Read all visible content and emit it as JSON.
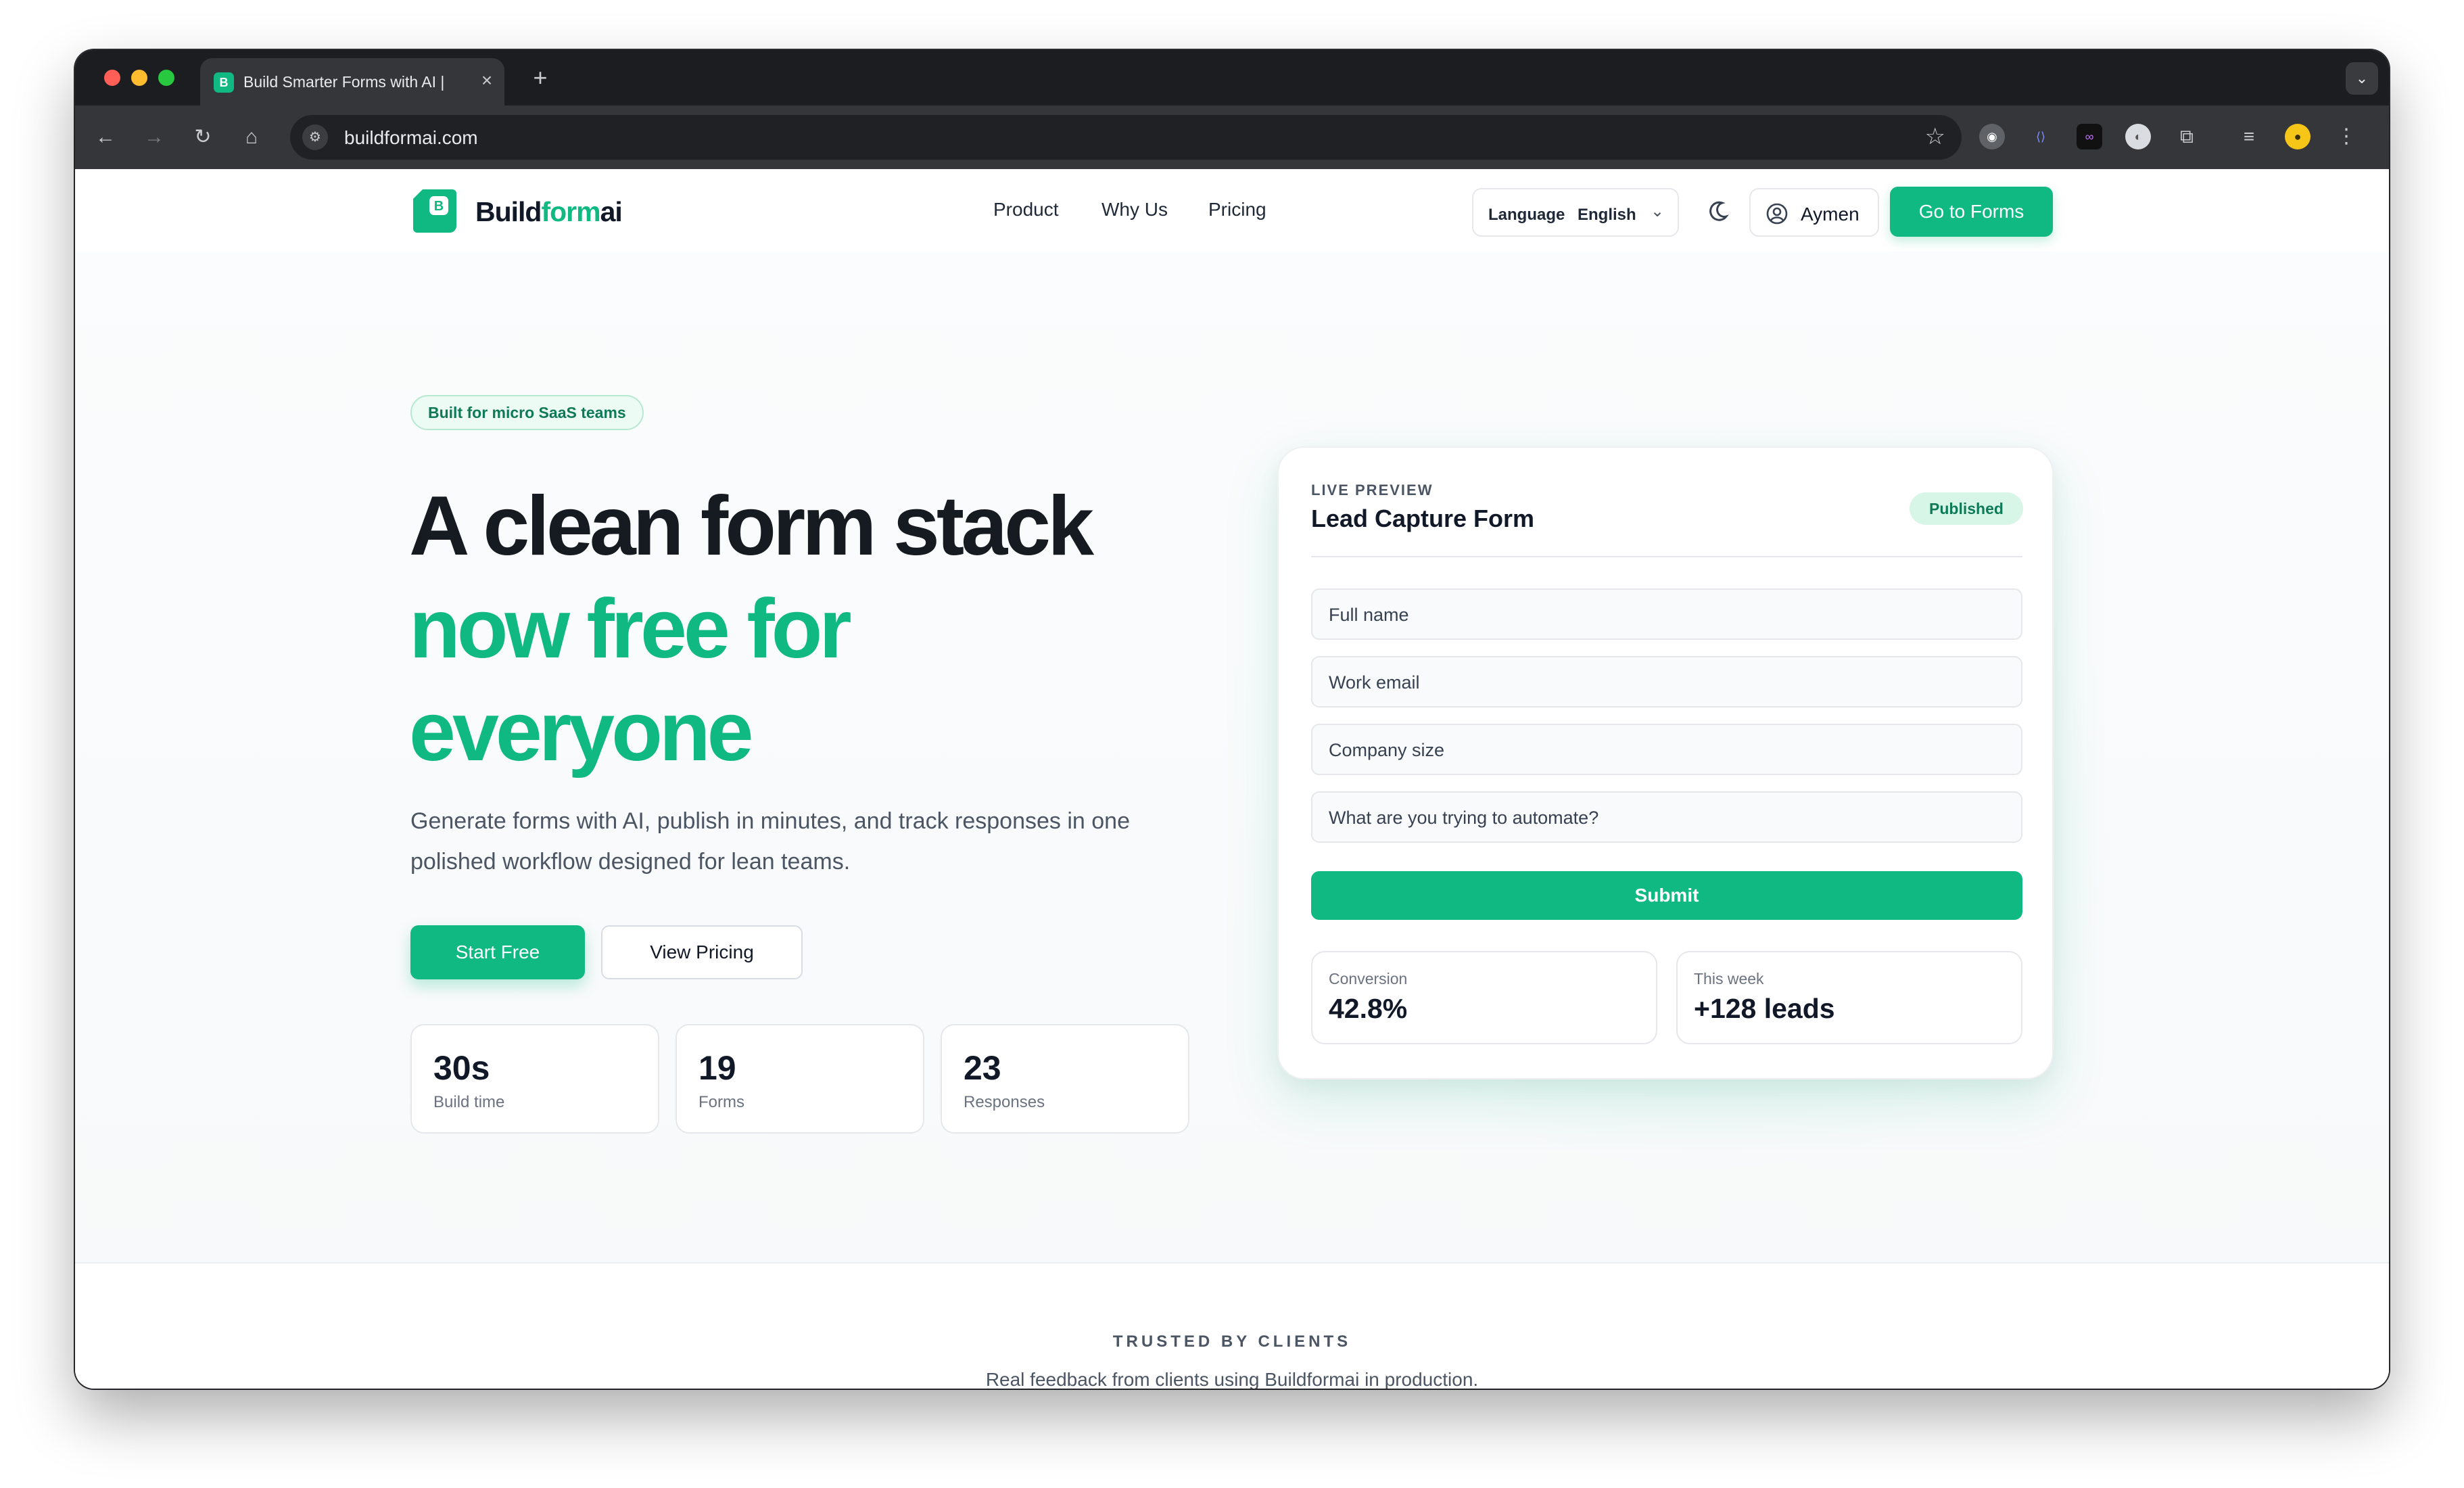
{
  "colors": {
    "accent": "#10b981",
    "window_chrome": "#202124",
    "toolbar": "#35363a"
  },
  "browser": {
    "tab_title": "Build Smarter Forms with AI |",
    "tab_favicon_letter": "B",
    "url": "buildformai.com",
    "icons": [
      "back-icon",
      "forward-icon",
      "reload-icon",
      "home-icon",
      "site-info-icon",
      "bookmark-star-icon",
      "extension-icons",
      "profile-avatar",
      "menu-icon"
    ]
  },
  "nav": {
    "logo": {
      "mark_letter": "B",
      "part1": "Build",
      "part2": "form",
      "part3": "ai"
    },
    "links": [
      "Product",
      "Why Us",
      "Pricing"
    ],
    "language_label": "Language",
    "language_value": "English",
    "user_name": "Aymen",
    "cta": "Go to Forms"
  },
  "hero": {
    "badge": "Built for micro SaaS teams",
    "title_line1": "A clean form stack",
    "title_line2": "now free for",
    "title_line3": "everyone",
    "subtitle": "Generate forms with AI, publish in minutes, and track responses in one polished workflow designed for lean teams.",
    "primary_button": "Start Free",
    "secondary_button": "View Pricing",
    "stats": [
      {
        "value": "30s",
        "label": "Build time"
      },
      {
        "value": "19",
        "label": "Forms"
      },
      {
        "value": "23",
        "label": "Responses"
      }
    ]
  },
  "preview": {
    "kicker": "LIVE PREVIEW",
    "title": "Lead Capture Form",
    "status": "Published",
    "fields": [
      "Full name",
      "Work email",
      "Company size",
      "What are you trying to automate?"
    ],
    "submit": "Submit",
    "metrics": [
      {
        "label": "Conversion",
        "value": "42.8%"
      },
      {
        "label": "This week",
        "value": "+128 leads"
      }
    ]
  },
  "trusted": {
    "heading": "TRUSTED BY CLIENTS",
    "text": "Real feedback from clients using Buildformai in production."
  }
}
